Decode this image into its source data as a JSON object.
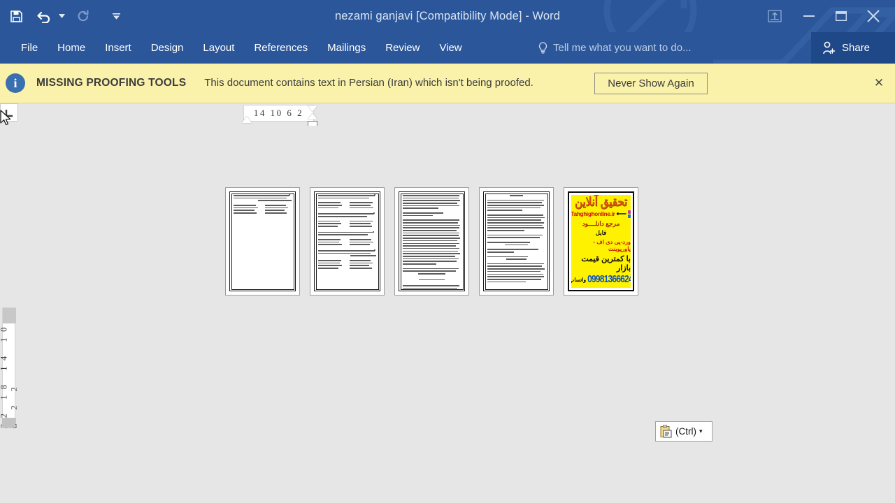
{
  "window": {
    "title": "nezami ganjavi [Compatibility Mode] - Word",
    "quick_access": [
      {
        "name": "save",
        "icon": "save-icon",
        "enabled": true
      },
      {
        "name": "undo",
        "icon": "undo-icon",
        "enabled": true
      },
      {
        "name": "redo",
        "icon": "redo-icon",
        "enabled": false
      },
      {
        "name": "customize-quick-access-toolbar",
        "icon": "chevron-down-icon",
        "enabled": true
      }
    ],
    "controls": {
      "ribbon_display_options": "ribbon-display-options-icon",
      "minimize": "minimize-icon",
      "restore": "restore-icon",
      "close": "close-icon"
    }
  },
  "ribbon": {
    "tabs": [
      {
        "label": "File",
        "active": false
      },
      {
        "label": "Home",
        "active": false
      },
      {
        "label": "Insert",
        "active": false
      },
      {
        "label": "Design",
        "active": false
      },
      {
        "label": "Layout",
        "active": false
      },
      {
        "label": "References",
        "active": false
      },
      {
        "label": "Mailings",
        "active": false
      },
      {
        "label": "Review",
        "active": false
      },
      {
        "label": "View",
        "active": false
      }
    ],
    "tell_me_placeholder": "Tell me what you want to do...",
    "share_label": "Share",
    "accent_color": "#2b579a",
    "share_bg_color": "#1e4887"
  },
  "notification": {
    "title": "MISSING PROOFING TOOLS",
    "message": "This document contains text in Persian (Iran) which isn't being proofed.",
    "action_label": "Never Show Again",
    "close_label": "✕",
    "info_glyph": "i",
    "background_color": "#faf2ab"
  },
  "rulers": {
    "horizontal_marks": "14 10  6   2",
    "vertical_marks": "22 18 14 10  6  2  2",
    "tab_stop_selector": "tab-stop-left-icon"
  },
  "document": {
    "zoom_note": "",
    "pages": [
      {
        "number": 1,
        "type": "text",
        "layout": "bullets-and-couplets"
      },
      {
        "number": 2,
        "type": "text",
        "layout": "bullets-and-couplets"
      },
      {
        "number": 3,
        "type": "text",
        "layout": "dense-paragraphs"
      },
      {
        "number": 4,
        "type": "text",
        "layout": "paragraphs"
      },
      {
        "number": 5,
        "type": "advertisement",
        "layout": "yellow-poster"
      }
    ],
    "ad_page": {
      "title": "تحقیق آنلاین",
      "url": "Tahghighonline.ir",
      "line1": "مرجع دانلــــود",
      "line2": "فایل",
      "line3": "ورد-پی دی اف - پاورپوینت",
      "line4": "با کمترین قیمت بازار",
      "phone": "09981366624",
      "whatsapp": "واتساپ",
      "background_color": "#fff200",
      "title_color": "#d44f12",
      "phone_color": "#0b52c4"
    }
  },
  "paste_options": {
    "label": "(Ctrl)",
    "icon": "clipboard-icon",
    "caret": "▾"
  },
  "colors": {
    "workspace": "#e6e6e6",
    "title_bar": "#2b579a",
    "notification": "#faf2ab"
  }
}
